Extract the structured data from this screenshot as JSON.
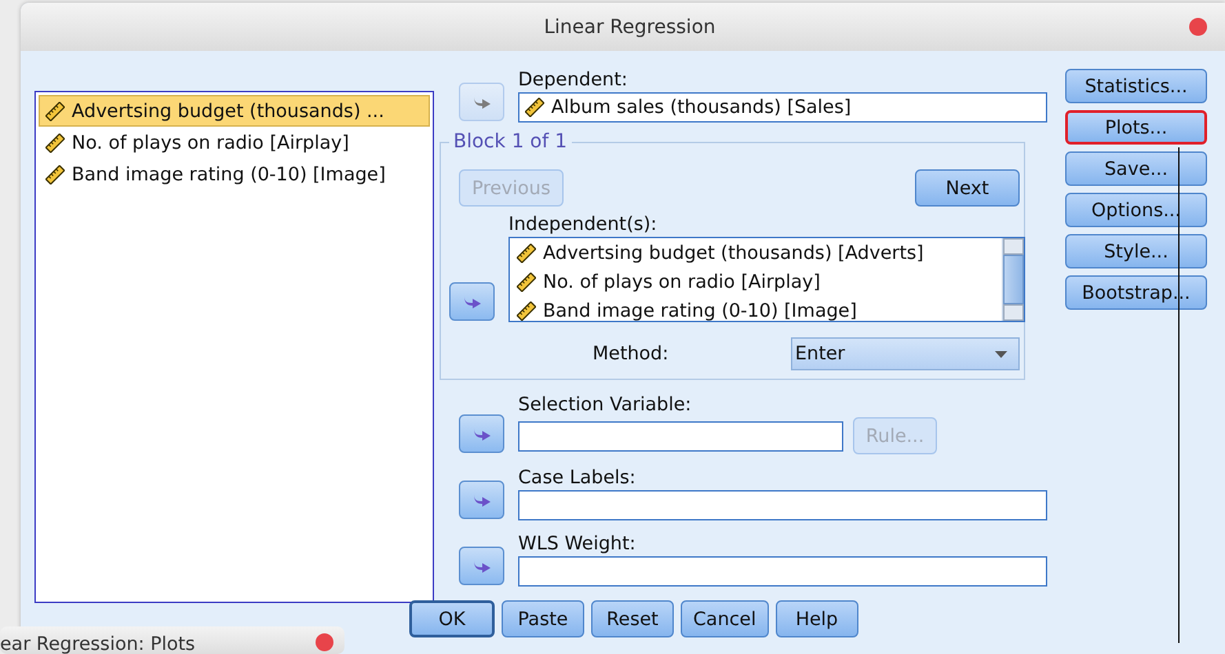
{
  "window": {
    "title": "Linear Regression"
  },
  "source_list": {
    "items": [
      {
        "label": "Advertsing budget (thousands) ...",
        "selected": true
      },
      {
        "label": "No. of plays on radio [Airplay]",
        "selected": false
      },
      {
        "label": "Band image rating (0-10) [Image]",
        "selected": false
      }
    ]
  },
  "dependent": {
    "label": "Dependent:",
    "arrow_disabled": true,
    "value": "Album sales (thousands) [Sales]"
  },
  "block": {
    "title": "Block 1 of 1",
    "buttons": [
      {
        "label": "Previous",
        "disabled": true
      },
      {
        "label": "Next",
        "disabled": false
      }
    ],
    "independents": {
      "label": "Independent(s):",
      "arrow_disabled": false,
      "items": [
        "Advertsing budget (thousands) [Adverts]",
        "No. of plays on radio [Airplay]",
        "Band image rating (0-10) [Image]"
      ]
    },
    "method": {
      "label": "Method:",
      "value": "Enter"
    }
  },
  "selection_variable": {
    "label": "Selection Variable:",
    "arrow_disabled": false,
    "rule": {
      "label": "Rule...",
      "disabled": true
    }
  },
  "case_labels": {
    "label": "Case Labels:",
    "arrow_disabled": false
  },
  "wls_weight": {
    "label": "WLS Weight:",
    "arrow_disabled": false
  },
  "side_buttons": [
    {
      "label": "Statistics...",
      "highlighted": false
    },
    {
      "label": "Plots...",
      "highlighted": true
    },
    {
      "label": "Save...",
      "highlighted": false
    },
    {
      "label": "Options...",
      "highlighted": false
    },
    {
      "label": "Style...",
      "highlighted": false
    },
    {
      "label": "Bootstrap...",
      "highlighted": false
    }
  ],
  "footer_buttons": [
    {
      "label": "OK",
      "default": true
    },
    {
      "label": "Paste",
      "default": false
    },
    {
      "label": "Reset",
      "default": false
    },
    {
      "label": "Cancel",
      "default": false
    },
    {
      "label": "Help",
      "default": false
    }
  ],
  "background_window": {
    "title": "ear Regression: Plots"
  }
}
